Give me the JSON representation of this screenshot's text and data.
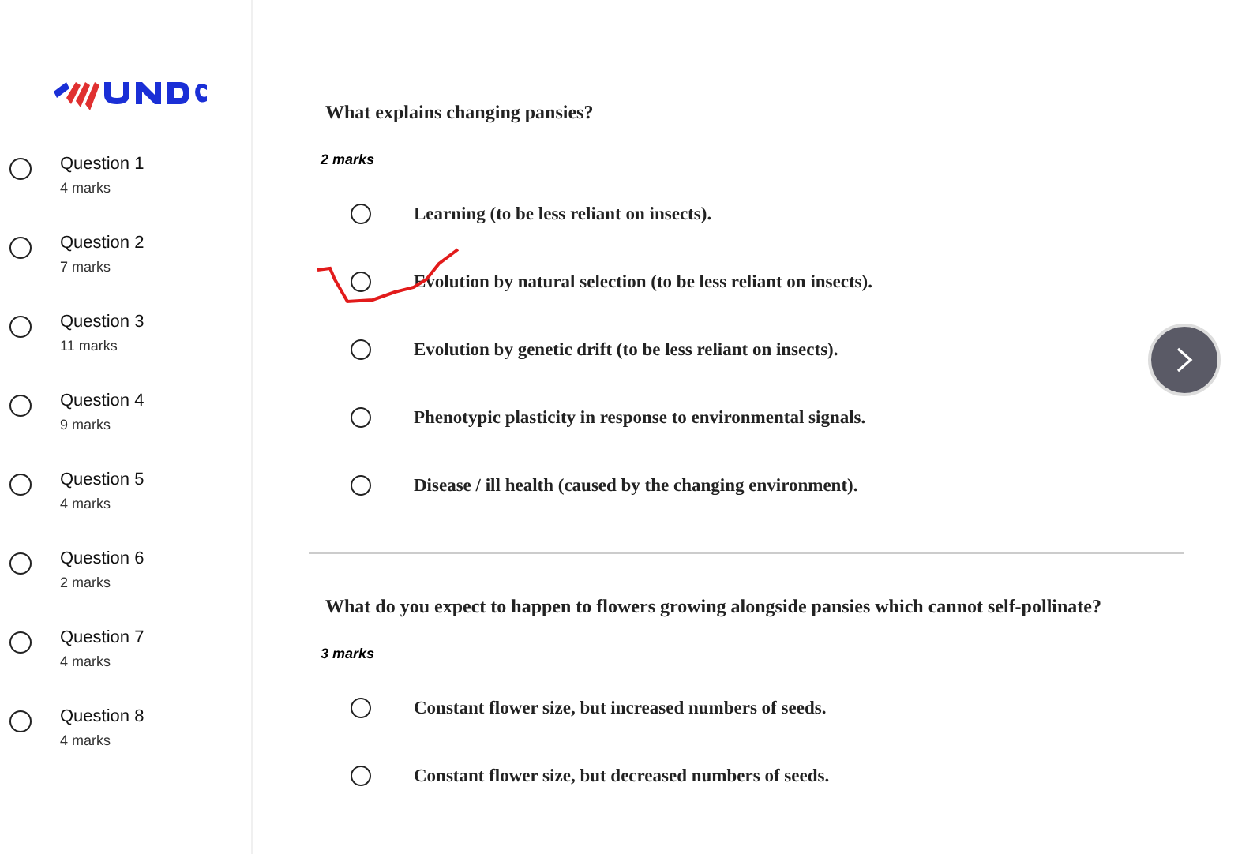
{
  "sidebar": {
    "questions": [
      {
        "label": "Question 1",
        "marks": "4 marks",
        "selected": false
      },
      {
        "label": "Question 2",
        "marks": "7 marks",
        "selected": false
      },
      {
        "label": "Question 3",
        "marks": "11 marks",
        "selected": false
      },
      {
        "label": "Question 4",
        "marks": "9 marks",
        "selected": false
      },
      {
        "label": "Question 5",
        "marks": "4 marks",
        "selected": false
      },
      {
        "label": "Question 6",
        "marks": "2 marks",
        "selected": false
      },
      {
        "label": "Question 7",
        "marks": "4 marks",
        "selected": false
      },
      {
        "label": "Question 8",
        "marks": "4 marks",
        "selected": false
      }
    ]
  },
  "questions": [
    {
      "prompt": "What explains changing pansies?",
      "marks": "2 marks",
      "options": [
        {
          "text": "Learning (to be less reliant on insects).",
          "selected": false,
          "ticked": false
        },
        {
          "text": "Evolution by natural selection (to be less reliant on insects).",
          "selected": false,
          "ticked": true
        },
        {
          "text": "Evolution by genetic drift (to be less reliant on insects).",
          "selected": false,
          "ticked": false
        },
        {
          "text": "Phenotypic plasticity in response to environmental signals.",
          "selected": false,
          "ticked": false
        },
        {
          "text": "Disease / ill health (caused by the changing environment).",
          "selected": false,
          "ticked": false
        }
      ]
    },
    {
      "prompt": "What do you expect to happen to flowers growing alongside pansies which cannot self-pollinate?",
      "marks": "3 marks",
      "options": [
        {
          "text": "Constant flower size, but increased numbers of seeds.",
          "selected": false,
          "ticked": false
        },
        {
          "text": "Constant flower size, but decreased numbers of seeds.",
          "selected": false,
          "ticked": false
        }
      ]
    }
  ]
}
